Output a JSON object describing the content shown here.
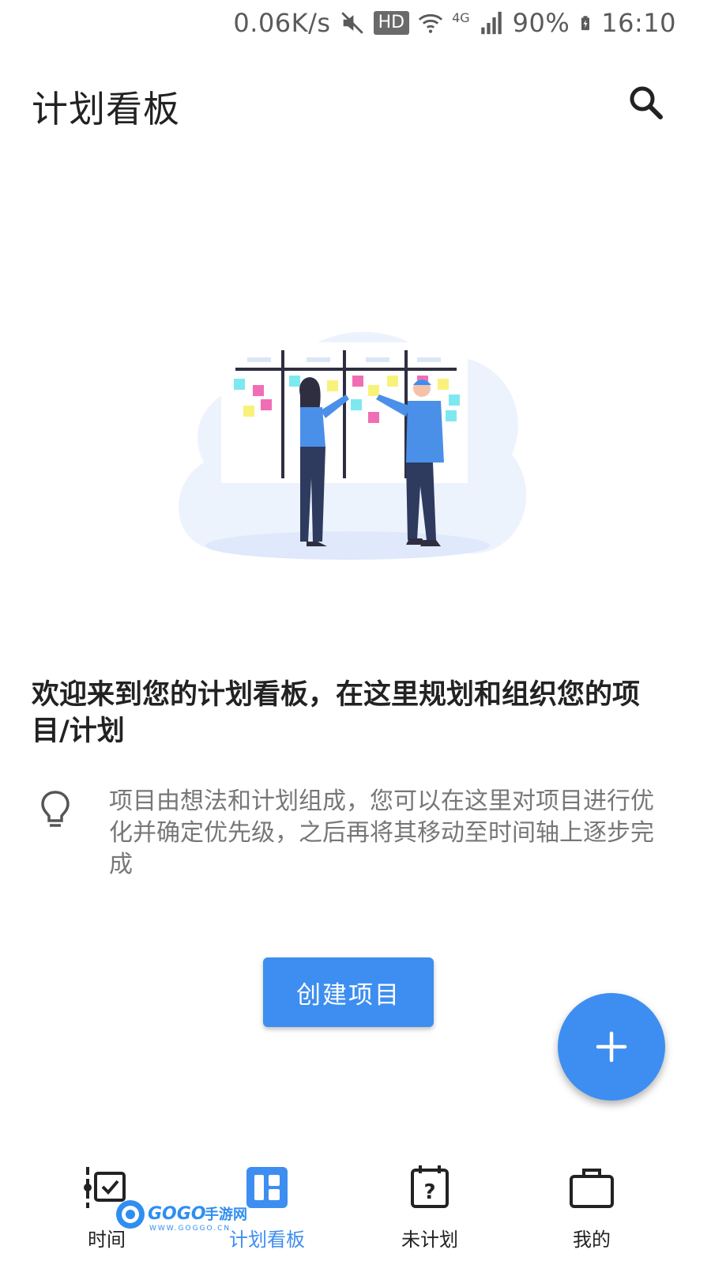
{
  "status_bar": {
    "network_speed": "0.06K/s",
    "hd_badge": "HD",
    "network_type": "4G",
    "battery": "90%",
    "time": "16:10",
    "icons": [
      "mute-icon",
      "wifi-icon",
      "signal-icon",
      "battery-charging-icon"
    ]
  },
  "header": {
    "title": "计划看板",
    "search_icon": "search-icon"
  },
  "illustration": {
    "icon": "kanban-board-people-illustration"
  },
  "main": {
    "welcome_heading": "欢迎来到您的计划看板，在这里规划和组织您的项目/计划",
    "tip_icon": "lightbulb-icon",
    "tip_text": "项目由想法和计划组成，您可以在这里对项目进行优化并确定优先级，之后再将其移动至时间轴上逐步完成",
    "create_button_label": "创建项目"
  },
  "fab": {
    "icon": "plus-icon"
  },
  "bottom_nav": {
    "active_index": 1,
    "items": [
      {
        "label": "时间",
        "icon": "timeline-checklist-icon"
      },
      {
        "label": "计划看板",
        "icon": "kanban-board-icon"
      },
      {
        "label": "未计划",
        "icon": "calendar-question-icon"
      },
      {
        "label": "我的",
        "icon": "briefcase-icon"
      }
    ]
  },
  "watermark": {
    "brand": "GOGO手游网",
    "url": "WWW.GOGGO.CN"
  },
  "colors": {
    "accent": "#3d8ef0",
    "text_primary": "#222222",
    "text_secondary": "#777777",
    "sticky_cyan": "#7ee8f0",
    "sticky_pink": "#f06eb4",
    "sticky_yellow": "#f9f27a"
  }
}
